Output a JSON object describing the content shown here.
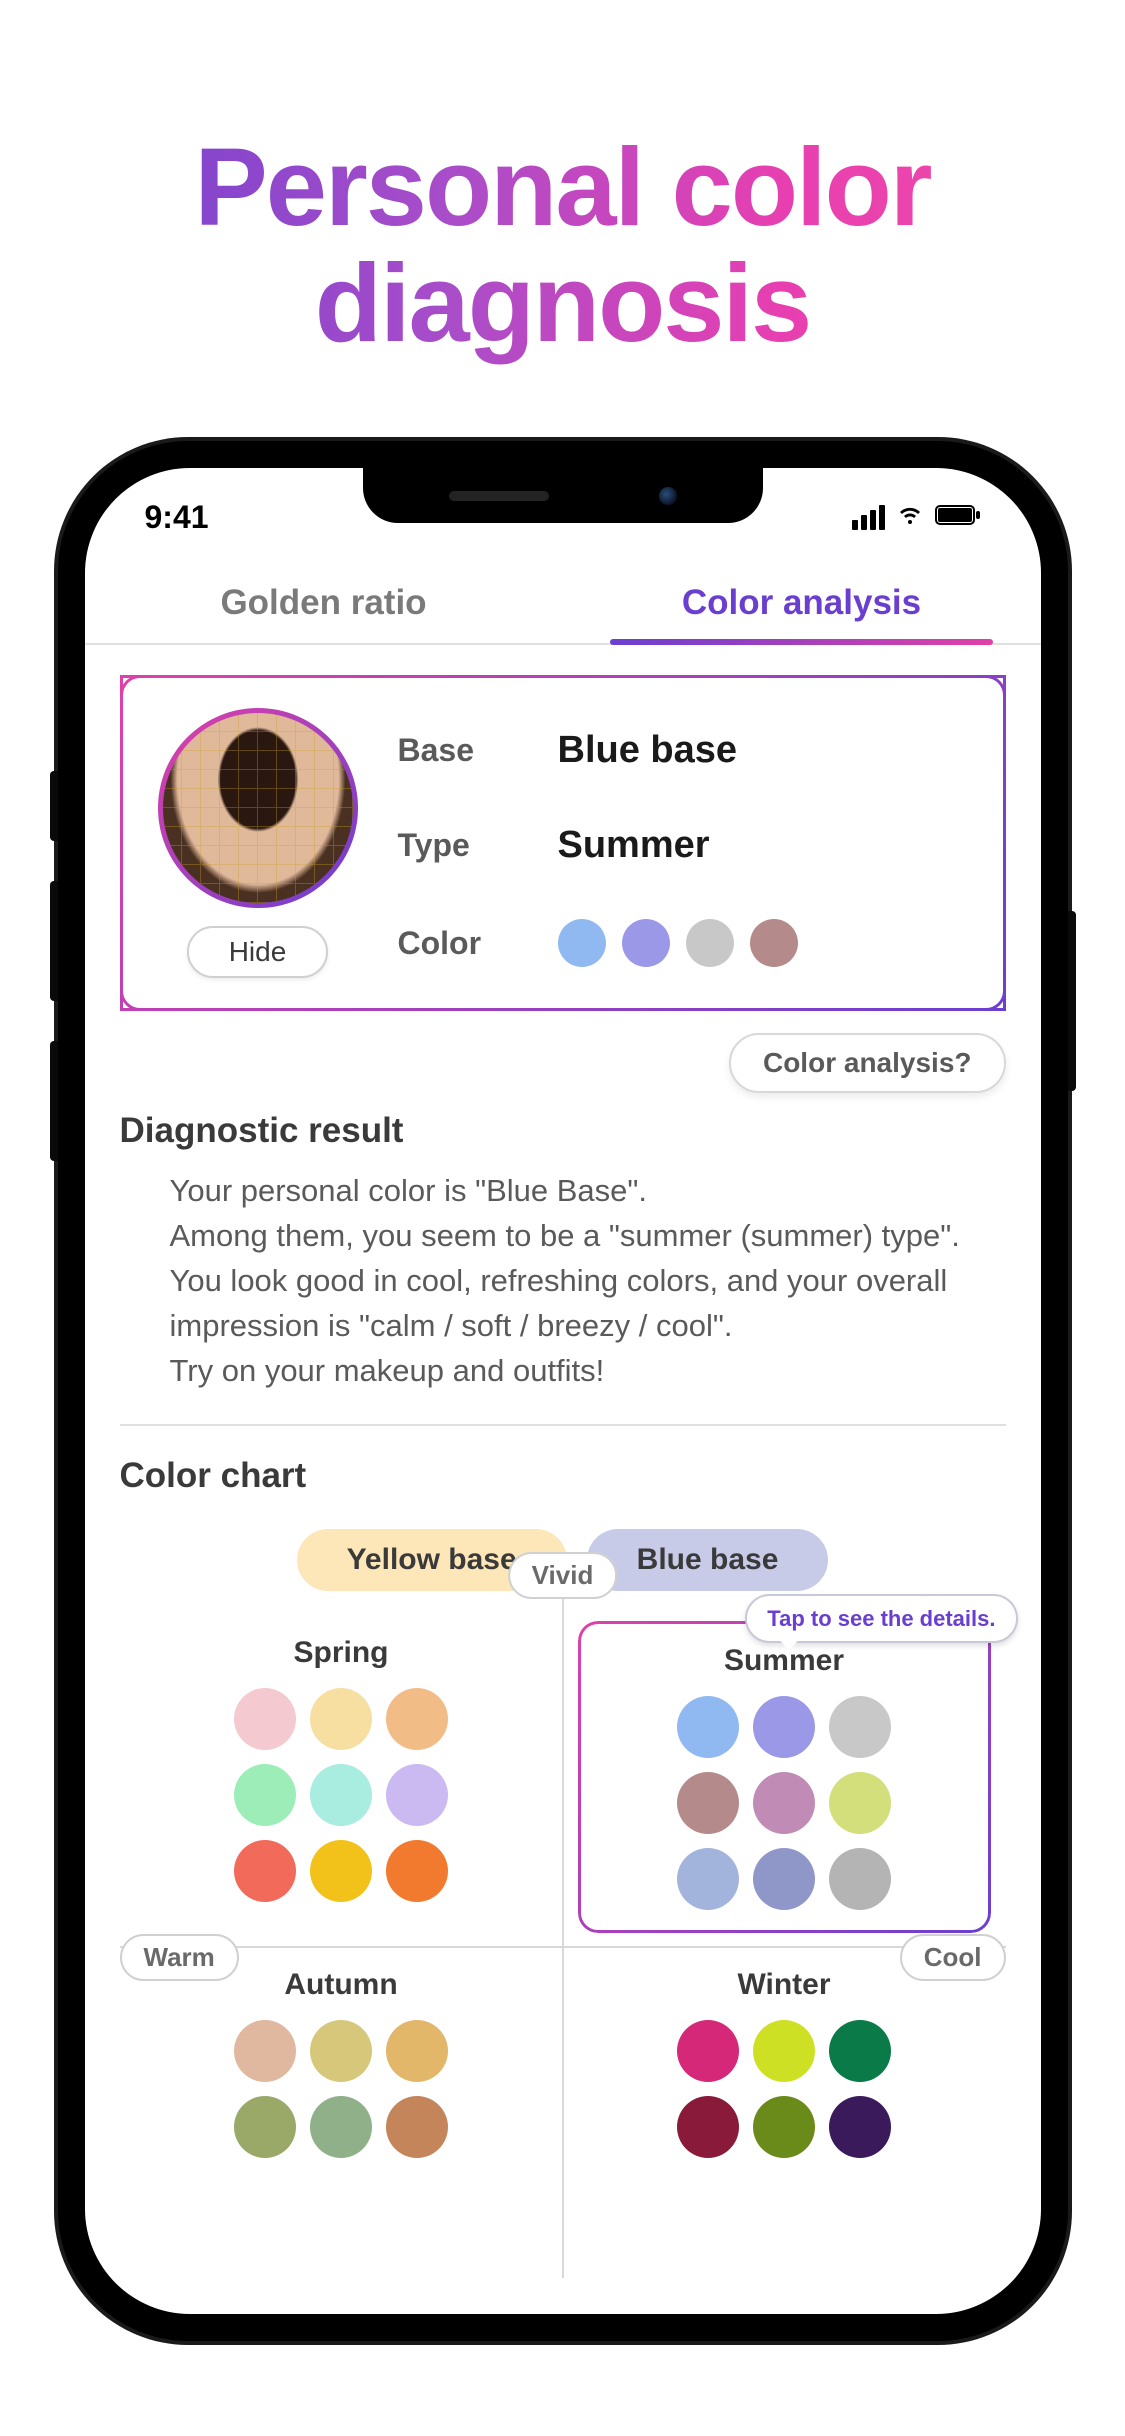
{
  "page_title": "Personal color diagnosis",
  "status": {
    "time": "9:41"
  },
  "tabs": {
    "golden_ratio": "Golden ratio",
    "color_analysis": "Color analysis"
  },
  "result_card": {
    "hide": "Hide",
    "base_label": "Base",
    "base_value": "Blue base",
    "type_label": "Type",
    "type_value": "Summer",
    "color_label": "Color",
    "colors": [
      "#8fb9f0",
      "#9b98e8",
      "#c8c8c8",
      "#b48a8a"
    ]
  },
  "help_button": "Color analysis?",
  "diagnostic": {
    "title": "Diagnostic result",
    "body": "Your personal color is \"Blue Base\".\nAmong them, you seem to be a \"summer (summer) type\".\nYou look good in cool, refreshing colors, and your overall impression is \"calm / soft / breezy / cool\".\nTry on your makeup and outfits!"
  },
  "color_chart": {
    "title": "Color chart",
    "yellow_base": "Yellow base",
    "blue_base": "Blue base",
    "axis_vivid": "Vivid",
    "axis_warm": "Warm",
    "axis_cool": "Cool",
    "tooltip": "Tap to see the details.",
    "seasons": {
      "spring": {
        "name": "Spring",
        "colors": [
          "#f4c9cf",
          "#f6dfa0",
          "#f2bc87",
          "#9dedb8",
          "#a8eddf",
          "#cbb9f2",
          "#f26a5a",
          "#f2c21a",
          "#f27a2e"
        ]
      },
      "summer": {
        "name": "Summer",
        "colors": [
          "#8fb9f0",
          "#9b98e8",
          "#c8c8c8",
          "#b48a8a",
          "#c08bb5",
          "#d3df7a",
          "#a3b4dc",
          "#8f96c8",
          "#b4b4b4"
        ]
      },
      "autumn": {
        "name": "Autumn",
        "colors": [
          "#e0b8a0",
          "#d6c77a",
          "#e2b76a",
          "#9aa868",
          "#8fb088",
          "#c4855a"
        ]
      },
      "winter": {
        "name": "Winter",
        "colors": [
          "#d62878",
          "#cde024",
          "#0a7a48",
          "#8a1a3a",
          "#6a8a1a",
          "#3a1a5a"
        ]
      }
    }
  }
}
